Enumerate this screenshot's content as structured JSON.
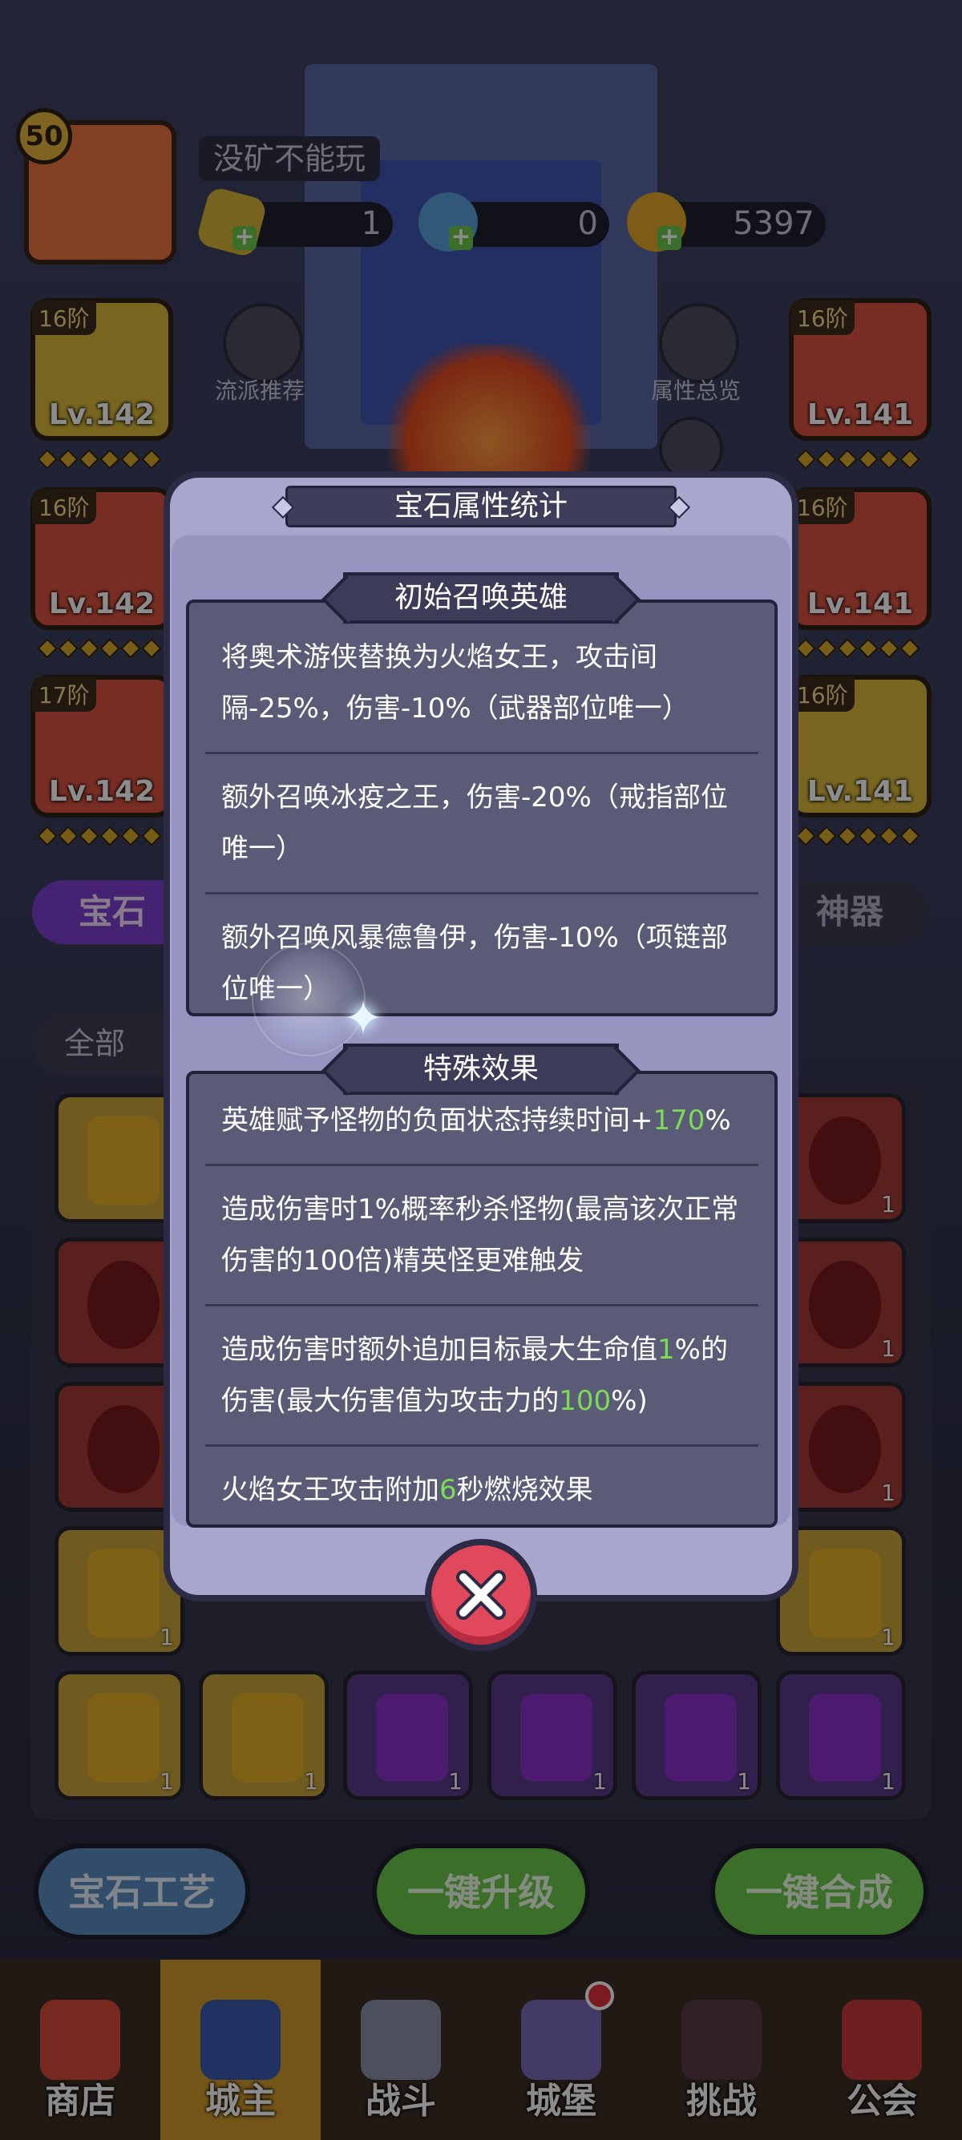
{
  "header": {
    "level": "50",
    "player_name": "没矿不能玩",
    "resources": {
      "gems": "1",
      "potions": "0",
      "coins": "5397"
    },
    "left_action_label": "流派推荐",
    "right_action_label": "属性总览"
  },
  "equipment": [
    {
      "tier": "16阶",
      "level": "Lv.142",
      "color": "#d8b83a"
    },
    {
      "tier": "16阶",
      "level": "Lv.142",
      "color": "#d8523f"
    },
    {
      "tier": "17阶",
      "level": "Lv.142",
      "color": "#d8523f"
    },
    {
      "tier": "16阶",
      "level": "Lv.141",
      "color": "#d8523f"
    },
    {
      "tier": "16阶",
      "level": "Lv.141",
      "color": "#d8523f"
    },
    {
      "tier": "16阶",
      "level": "Lv.141",
      "color": "#d8b83a"
    }
  ],
  "tabs": {
    "gem": "宝石",
    "artifact": "神器"
  },
  "filter": {
    "all": "全部"
  },
  "inventory_counts": [
    "1",
    "1",
    "1",
    "1",
    "1",
    "1",
    "1",
    "1",
    "1",
    "1",
    "1",
    "1",
    "1",
    "1",
    "1",
    "1"
  ],
  "bottom_buttons": {
    "craft": "宝石工艺",
    "upgrade": "一键升级",
    "merge": "一键合成"
  },
  "nav": [
    {
      "label": "商店",
      "icon": "shop-icon"
    },
    {
      "label": "城主",
      "icon": "crown-icon"
    },
    {
      "label": "战斗",
      "icon": "swords-icon"
    },
    {
      "label": "城堡",
      "icon": "castle-icon"
    },
    {
      "label": "挑战",
      "icon": "demon-icon"
    },
    {
      "label": "公会",
      "icon": "guild-banner-icon"
    }
  ],
  "dialog": {
    "title": "宝石属性统计",
    "section1": {
      "title": "初始召唤英雄",
      "rows": [
        "将奥术游侠替换为火焰女王，攻击间隔-25%，伤害-10%（武器部位唯一）",
        "额外召唤冰疫之王，伤害-20%（戒指部位唯一）",
        "额外召唤风暴德鲁伊，伤害-10%（项链部位唯一）"
      ]
    },
    "section2": {
      "title": "特殊效果",
      "row1_pre": "英雄赋予怪物的负面状态持续时间+",
      "row1_num": "170",
      "row1_post": "%",
      "row2": "造成伤害时1%概率秒杀怪物(最高该次正常伤害的100倍)精英怪更难触发",
      "row3_pre": "造成伤害时额外追加目标最大生命值",
      "row3_num1": "1",
      "row3_mid": "%的伤害(最大伤害值为攻击力的",
      "row3_num2": "100",
      "row3_post": "%)",
      "row4_pre": "火焰女王攻击附加",
      "row4_num": "6",
      "row4_post": "秒燃烧效果"
    },
    "accent_green": "#7ed957"
  }
}
